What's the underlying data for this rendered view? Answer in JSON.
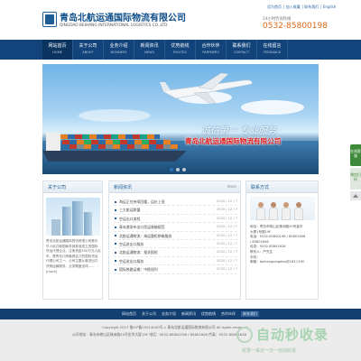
{
  "header": {
    "company_cn": "青岛北航运通国际物流有限公司",
    "company_en": "QINGDAO BEIHANG INTERNATIONAL LOGISTICS CO.,LTD",
    "top_links": [
      "设为首页",
      "加入收藏",
      "联系我们",
      "English"
    ],
    "hotline_label": "24小时咨询热线",
    "hotline": "0532-85800198"
  },
  "nav": [
    {
      "cn": "网站首页",
      "en": "HOME",
      "active": true
    },
    {
      "cn": "关于公司",
      "en": "ABOUT"
    },
    {
      "cn": "业务介绍",
      "en": "BUSINESS"
    },
    {
      "cn": "新闻资讯",
      "en": "NEWS"
    },
    {
      "cn": "优势航线",
      "en": "ROUTES"
    },
    {
      "cn": "合作伙伴",
      "en": "PARTNERS"
    },
    {
      "cn": "联系我们",
      "en": "CONTACT"
    },
    {
      "cn": "在线留言",
      "en": "FEEDBACK"
    }
  ],
  "banner": {
    "tagline": "诚信第一 专业服务",
    "company": "青岛北航运通国际物流有限公司"
  },
  "about": {
    "title": "关于公司",
    "more": "more",
    "text": "青岛北航运通国际物流有限公司是中华人民共和国商务部批准成立的国际货运代理企业，注册资金500万元人民币，是青岛口岸最具实力的国际货运代理公司之一。公司主要从事进出口货物运输服务，业务覆盖全球......[more]"
  },
  "news": {
    "title": "新闻资讯",
    "more": "more",
    "items": [
      {
        "t": "海运正在持续回暖，运价上涨",
        "d": "2020 / 12 / 7"
      },
      {
        "t": "三大航运联盟",
        "d": "2020 / 12 / 7"
      },
      {
        "t": "空运出口流程",
        "d": "2020 / 12 / 7"
      },
      {
        "t": "青岛港发布出口货运装箱规范",
        "d": "2020 / 12 / 7"
      },
      {
        "t": "北航运通物流：海运整柜拼箱服务",
        "d": "2020 / 12 / 7"
      },
      {
        "t": "空运进出口服务",
        "d": "2020 / 12 / 7"
      },
      {
        "t": "北航运通物流：报关报检",
        "d": "2020 / 12 / 7"
      },
      {
        "t": "空运进出口服务",
        "d": "2020 / 12 / 7"
      },
      {
        "t": "国际铁路运输：中欧班列",
        "d": "2020 / 12 / 7"
      }
    ]
  },
  "contact": {
    "title": "联系方式",
    "more": "more",
    "lines": [
      "地址：青岛市崂山区株洲路20号金华",
      "大厦1号楼19F",
      "电话：0532-85800198 / 85801608",
      "/ 85801608",
      "传真：0532-85801628",
      "联系人：严先生",
      "手机：",
      "邮箱：beihangqingdao@163.COM"
    ]
  },
  "footer": {
    "nav": [
      "网站首页",
      "关于公司",
      "业务介绍",
      "新闻资讯",
      "优势航线",
      "合作伙伴",
      "联系我们"
    ],
    "nav_highlight": "联系我们",
    "copyright": "Copyright 2017 鲁ICP备15014040号-1 青岛北航运通国际物流有限公司 All rights reserved",
    "address": "公司地址：青岛市崂山区株洲路20号金华大厦19F  电话：0532-85800198 / 85801608  传真：0532-85801628"
  },
  "watermark": {
    "text": "自动秒收录",
    "sub": "收录一来访一次一自动收录"
  },
  "side": {
    "online": "在线客服",
    "wechat": "微信扫码"
  }
}
